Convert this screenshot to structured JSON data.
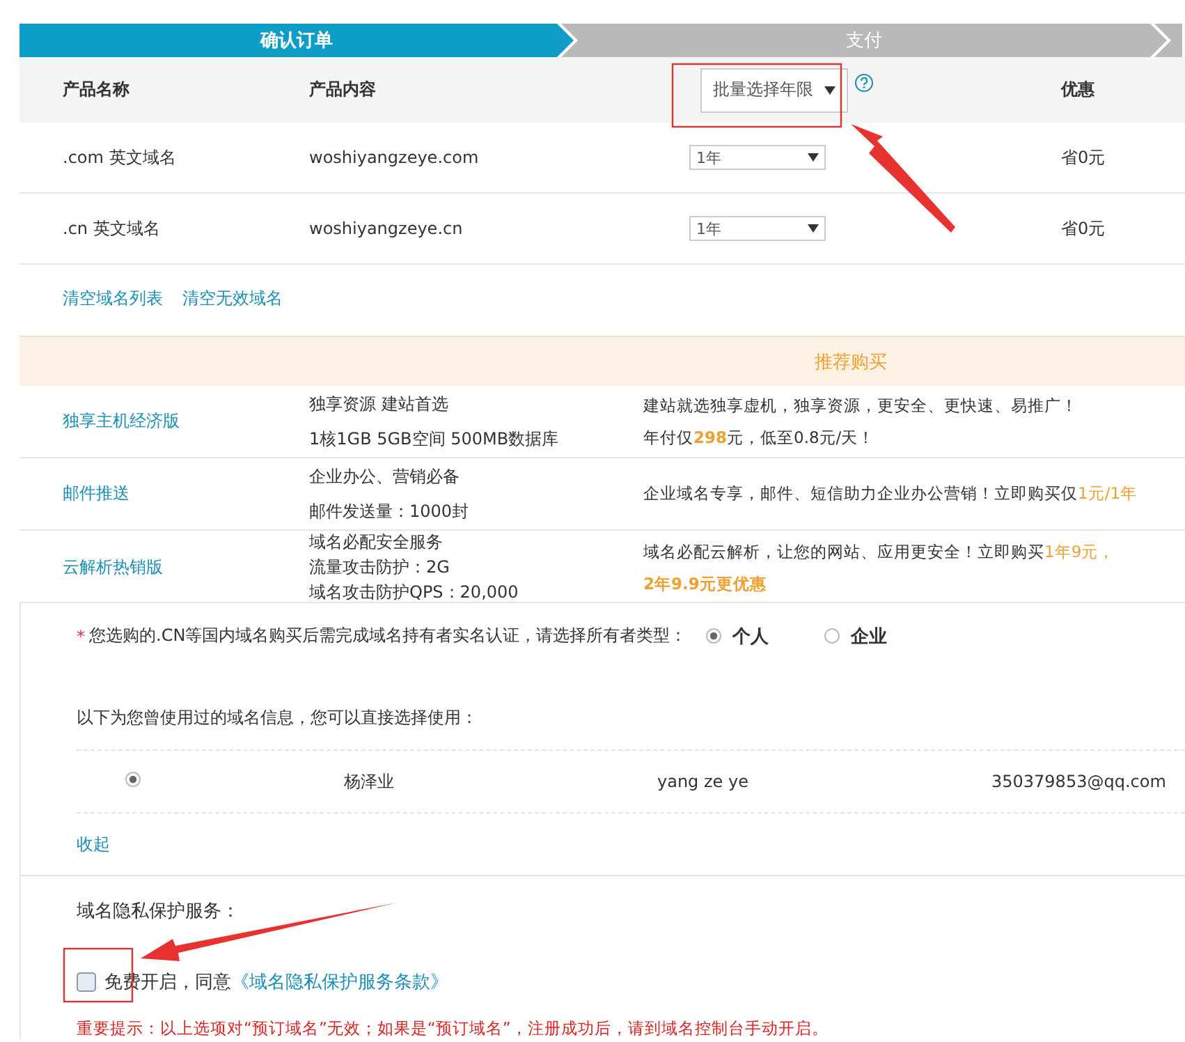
{
  "steps": [
    {
      "label": "确认订单",
      "selected": true
    },
    {
      "label": "支付",
      "selected": false
    }
  ],
  "order_table": {
    "columns": [
      "产品名称",
      "产品内容"
    ],
    "bulk_select": {
      "value": "批量选择年限"
    },
    "discount_column": "优惠",
    "rows": [
      {
        "name": ".com 英文域名",
        "content": "woshiyangzeye.com",
        "term": "1年",
        "discount": "省0元"
      },
      {
        "name": ".cn 英文域名",
        "content": "woshiyangzeye.cn",
        "term": "1年",
        "discount": "省0元"
      }
    ]
  },
  "list_links": [
    "清空域名列表",
    "清空无效域名"
  ],
  "recommend": {
    "title": "推荐购买",
    "rows": [
      {
        "name": "独享主机经济版",
        "features": [
          "独享资源 建站首选",
          "1核1GB 5GB空间 500MB数据库"
        ],
        "description": [
          [
            {
              "text": "建站就选独享虚机，独享资源，更安全、更快速、易推广！",
              "highlight": false
            }
          ],
          [
            {
              "text": "年付仅",
              "highlight": false
            },
            {
              "text": "**298**",
              "highlight": true
            },
            {
              "text": "元，低至0.8元/天！",
              "highlight": false
            }
          ]
        ]
      },
      {
        "name": "邮件推送",
        "features": [
          "企业办公、营销必备",
          "邮件发送量：1000封"
        ],
        "description": [
          [
            {
              "text": "企业域名专享，邮件、短信助力企业办公营销！立即购买仅",
              "highlight": false
            },
            {
              "text": "1元/1年",
              "highlight": true
            }
          ]
        ]
      },
      {
        "name": "云解析热销版",
        "features": [
          "域名必配安全服务",
          "流量攻击防护：2G",
          "域名攻击防护QPS：20,000"
        ],
        "description": [
          [
            {
              "text": "域名必配云解析，让您的网站、应用更安全！立即购买",
              "highlight": false
            },
            {
              "text": "1年9元，",
              "highlight": true
            }
          ],
          [
            {
              "text": "**2年9.9元更优惠**",
              "highlight": true
            }
          ]
        ]
      }
    ]
  },
  "owner": {
    "required_mark": "*",
    "prompt": "您选购的.CN等国内域名购买后需完成域名持有者实名认证，请选择所有者类型：",
    "options": [
      {
        "label": "个人",
        "selected": true
      },
      {
        "label": "企业",
        "selected": false
      }
    ]
  },
  "history": {
    "intro": "以下为您曾使用过的域名信息，您可以直接选择使用：",
    "contacts": [
      {
        "selected": true,
        "name_cn": "杨泽业",
        "name_en": "yang ze ye",
        "email": "350379853@qq.com"
      }
    ],
    "collapse_link": "收起"
  },
  "privacy": {
    "title": "域名隐私保护服务：",
    "checked": false,
    "agree_text": "免费开启，同意",
    "terms_link": "《域名隐私保护服务条款》",
    "notice": "重要提示：以上选项对“预订域名”无效；如果是“预订域名”，注册成功后，请到域名控制台手动开启。"
  }
}
